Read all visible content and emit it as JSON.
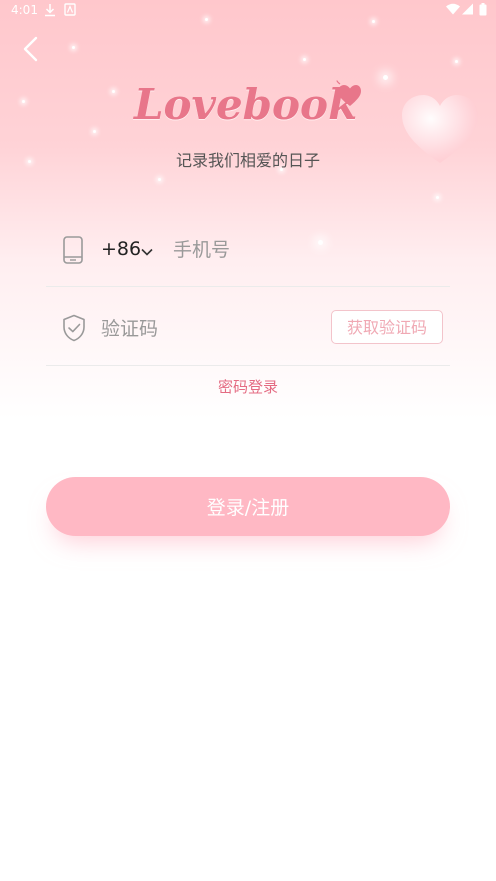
{
  "status_bar": {
    "time": "4:01"
  },
  "header": {
    "back_icon": "chevron-left-icon",
    "logo_text": "Lovebook",
    "tagline": "记录我们相爱的日子"
  },
  "phone_field": {
    "icon": "phone-icon",
    "country_code": "+86",
    "placeholder": "手机号",
    "value": ""
  },
  "code_field": {
    "icon": "shield-check-icon",
    "placeholder": "验证码",
    "value": "",
    "get_code_label": "获取验证码"
  },
  "password_login_label": "密码登录",
  "submit_label": "登录/注册",
  "colors": {
    "accent": "#e46c83",
    "button": "#ffb8c4",
    "header_pink": "#ffc7cc"
  }
}
